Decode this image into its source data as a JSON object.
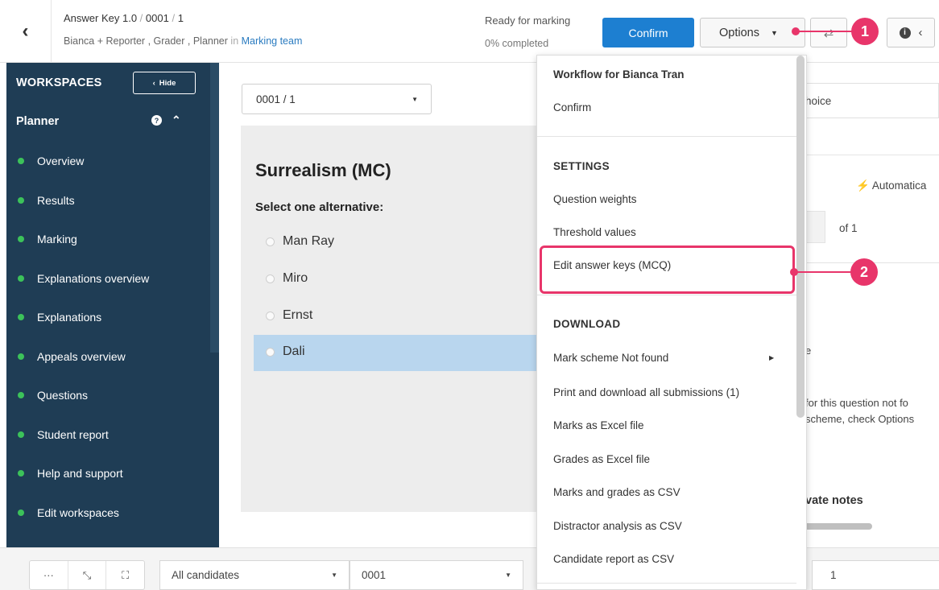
{
  "header": {
    "back_icon": "chevron-left-icon",
    "breadcrumb": {
      "title": "Answer Key 1.0",
      "sep1": "/",
      "part2": "0001",
      "sep2": "/",
      "part3": "1"
    },
    "subcrumb": {
      "people": "Bianca + Reporter , Grader , Planner",
      "in": "in",
      "team": "Marking team"
    },
    "status": "Ready for marking",
    "progress": "0% completed",
    "confirm_label": "Confirm",
    "options_label": "Options",
    "swap_icon": "swap-arrows-icon",
    "info_icon": "info-icon",
    "collapse_icon": "chevron-left-icon"
  },
  "callouts": {
    "one": "1",
    "two": "2",
    "color": "#e8356a"
  },
  "sidebar": {
    "title": "WORKSPACES",
    "hide_label": "Hide",
    "section": "Planner",
    "items": [
      {
        "label": "Overview"
      },
      {
        "label": "Results"
      },
      {
        "label": "Marking"
      },
      {
        "label": "Explanations overview"
      },
      {
        "label": "Explanations"
      },
      {
        "label": "Appeals overview"
      },
      {
        "label": "Questions"
      },
      {
        "label": "Student report"
      },
      {
        "label": "Help and support"
      },
      {
        "label": "Edit workspaces"
      }
    ],
    "bg_color": "#1f3d55",
    "dot_color": "#3cc25a"
  },
  "question": {
    "selector_value": "0001 / 1",
    "title": "Surrealism (MC)",
    "prompt": "Select one alternative:",
    "options": [
      {
        "label": "Man Ray",
        "selected": false
      },
      {
        "label": "Miro",
        "selected": false
      },
      {
        "label": "Ernst",
        "selected": false
      },
      {
        "label": "Dali",
        "selected": true
      }
    ]
  },
  "right_panel": {
    "choice_text": "hoice",
    "auto_text": "Automatica",
    "of_text": "of 1",
    "e_text": "e",
    "line1": "for this question not fo",
    "line2": "scheme, check Options",
    "notes_label": "vate notes"
  },
  "menu": {
    "workflow_head": "Workflow for Bianca Tran",
    "workflow_confirm": "Confirm",
    "settings_head": "SETTINGS",
    "question_weights": "Question weights",
    "threshold_values": "Threshold values",
    "edit_answer_keys": "Edit answer keys (MCQ)",
    "download_head": "DOWNLOAD",
    "downloads": [
      {
        "label": "Mark scheme Not found"
      },
      {
        "label": "Print and download all submissions (1)"
      },
      {
        "label": "Marks as Excel file"
      },
      {
        "label": "Grades as Excel file"
      },
      {
        "label": "Marks and grades as CSV"
      },
      {
        "label": "Distractor analysis as CSV"
      },
      {
        "label": "Candidate report as CSV"
      }
    ]
  },
  "bottombar": {
    "more_icon": "more-icon",
    "shrink_icon": "shrink-icon",
    "fullscreen_icon": "fullscreen-icon",
    "candidates_value": "All candidates",
    "candidate_id": "0001",
    "page_value": "1"
  },
  "accent_color": "#1d7fd1"
}
